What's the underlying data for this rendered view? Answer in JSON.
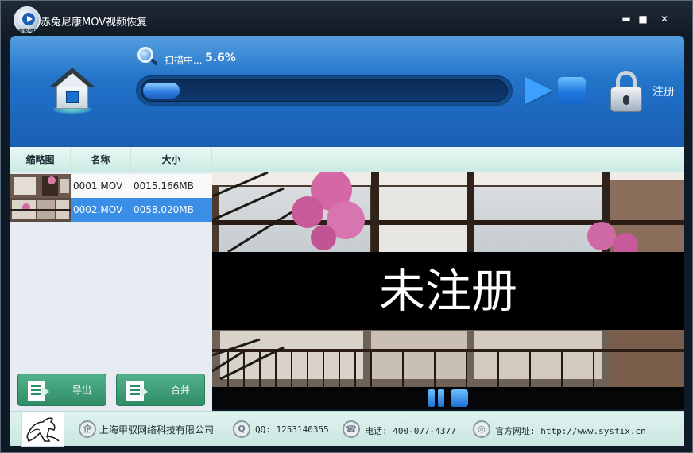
{
  "window": {
    "title": "赤兔尼康MOV视频恢复",
    "logo_text": "赤兔MOV",
    "minimize": "▬",
    "maximize": "■",
    "close": "✕"
  },
  "header": {
    "scan_label": "扫描中...",
    "scan_percent": "5.6%",
    "progress": 0.056,
    "register_label": "注册"
  },
  "table": {
    "columns": [
      "缩略图",
      "名称",
      "大小"
    ],
    "rows": [
      {
        "name": "0001.MOV",
        "size": "0015.166MB",
        "selected": false
      },
      {
        "name": "0002.MOV",
        "size": "0058.020MB",
        "selected": true
      }
    ]
  },
  "actions": {
    "export_label": "导出",
    "merge_label": "合并"
  },
  "preview": {
    "watermark": "未注册"
  },
  "footer": {
    "company": "上海甲驭网络科技有限公司",
    "qq": "QQ: 1253140355",
    "phone": "电话: 400-077-4377",
    "website": "官方网址: http://www.sysfix.cn"
  },
  "colors": {
    "header_blue": "#1f6dc4",
    "selected_row": "#3a8ee6",
    "action_green": "#2f8c66",
    "watermark_bg": "#000000"
  }
}
